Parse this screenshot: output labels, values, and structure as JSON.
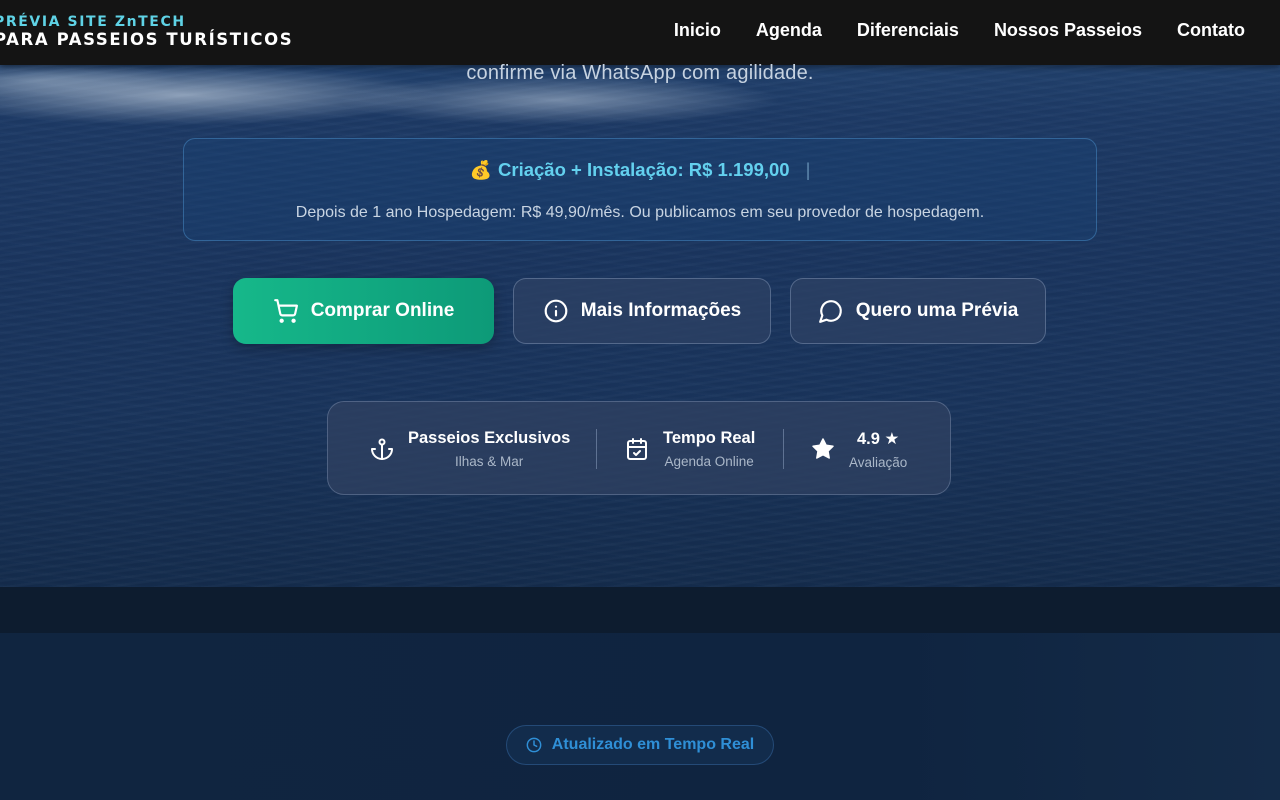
{
  "brand": {
    "line1": "PRÉVIA SITE ZnTECH",
    "line2": "PARA PASSEIOS TURÍSTICOS"
  },
  "nav": {
    "items": [
      {
        "label": "Inicio"
      },
      {
        "label": "Agenda"
      },
      {
        "label": "Diferenciais"
      },
      {
        "label": "Nossos Passeios"
      },
      {
        "label": "Contato"
      }
    ]
  },
  "hero": {
    "subtitle": "confirme via WhatsApp com agilidade."
  },
  "pricing": {
    "icon": "money-bag-icon",
    "title": "Criação + Instalação: R$ 1.199,00",
    "separator": "|",
    "note": "Depois de 1 ano Hospedagem: R$ 49,90/mês. Ou publicamos em seu provedor de hospedagem."
  },
  "actions": {
    "buy": {
      "label": "Comprar Online",
      "icon": "cart-icon"
    },
    "info": {
      "label": "Mais Informações",
      "icon": "info-icon"
    },
    "preview": {
      "label": "Quero uma Prévia",
      "icon": "chat-icon"
    }
  },
  "stats": [
    {
      "title": "Passeios Exclusivos",
      "subtitle": "Ilhas & Mar",
      "icon": "anchor-icon"
    },
    {
      "title": "Tempo Real",
      "subtitle": "Agenda Online",
      "icon": "calendar-check-icon"
    },
    {
      "title": "4.9 ★",
      "subtitle": "Avaliação",
      "icon": "star-icon"
    }
  ],
  "badge": {
    "label": "Atualizado em Tempo Real",
    "icon": "clock-icon"
  },
  "colors": {
    "brand_accent": "#5fd3e6",
    "buy_button": "#16b88a",
    "price_accent": "#63d0ee",
    "badge_text": "#2f8fd6"
  }
}
